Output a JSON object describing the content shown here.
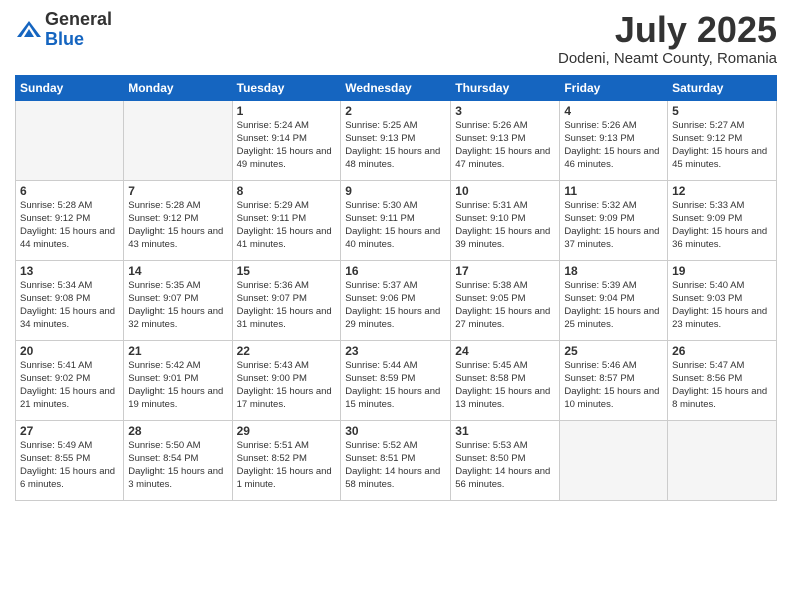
{
  "header": {
    "logo_general": "General",
    "logo_blue": "Blue",
    "month": "July 2025",
    "location": "Dodeni, Neamt County, Romania"
  },
  "weekdays": [
    "Sunday",
    "Monday",
    "Tuesday",
    "Wednesday",
    "Thursday",
    "Friday",
    "Saturday"
  ],
  "weeks": [
    [
      {
        "day": "",
        "info": ""
      },
      {
        "day": "",
        "info": ""
      },
      {
        "day": "1",
        "info": "Sunrise: 5:24 AM\nSunset: 9:14 PM\nDaylight: 15 hours and 49 minutes."
      },
      {
        "day": "2",
        "info": "Sunrise: 5:25 AM\nSunset: 9:13 PM\nDaylight: 15 hours and 48 minutes."
      },
      {
        "day": "3",
        "info": "Sunrise: 5:26 AM\nSunset: 9:13 PM\nDaylight: 15 hours and 47 minutes."
      },
      {
        "day": "4",
        "info": "Sunrise: 5:26 AM\nSunset: 9:13 PM\nDaylight: 15 hours and 46 minutes."
      },
      {
        "day": "5",
        "info": "Sunrise: 5:27 AM\nSunset: 9:12 PM\nDaylight: 15 hours and 45 minutes."
      }
    ],
    [
      {
        "day": "6",
        "info": "Sunrise: 5:28 AM\nSunset: 9:12 PM\nDaylight: 15 hours and 44 minutes."
      },
      {
        "day": "7",
        "info": "Sunrise: 5:28 AM\nSunset: 9:12 PM\nDaylight: 15 hours and 43 minutes."
      },
      {
        "day": "8",
        "info": "Sunrise: 5:29 AM\nSunset: 9:11 PM\nDaylight: 15 hours and 41 minutes."
      },
      {
        "day": "9",
        "info": "Sunrise: 5:30 AM\nSunset: 9:11 PM\nDaylight: 15 hours and 40 minutes."
      },
      {
        "day": "10",
        "info": "Sunrise: 5:31 AM\nSunset: 9:10 PM\nDaylight: 15 hours and 39 minutes."
      },
      {
        "day": "11",
        "info": "Sunrise: 5:32 AM\nSunset: 9:09 PM\nDaylight: 15 hours and 37 minutes."
      },
      {
        "day": "12",
        "info": "Sunrise: 5:33 AM\nSunset: 9:09 PM\nDaylight: 15 hours and 36 minutes."
      }
    ],
    [
      {
        "day": "13",
        "info": "Sunrise: 5:34 AM\nSunset: 9:08 PM\nDaylight: 15 hours and 34 minutes."
      },
      {
        "day": "14",
        "info": "Sunrise: 5:35 AM\nSunset: 9:07 PM\nDaylight: 15 hours and 32 minutes."
      },
      {
        "day": "15",
        "info": "Sunrise: 5:36 AM\nSunset: 9:07 PM\nDaylight: 15 hours and 31 minutes."
      },
      {
        "day": "16",
        "info": "Sunrise: 5:37 AM\nSunset: 9:06 PM\nDaylight: 15 hours and 29 minutes."
      },
      {
        "day": "17",
        "info": "Sunrise: 5:38 AM\nSunset: 9:05 PM\nDaylight: 15 hours and 27 minutes."
      },
      {
        "day": "18",
        "info": "Sunrise: 5:39 AM\nSunset: 9:04 PM\nDaylight: 15 hours and 25 minutes."
      },
      {
        "day": "19",
        "info": "Sunrise: 5:40 AM\nSunset: 9:03 PM\nDaylight: 15 hours and 23 minutes."
      }
    ],
    [
      {
        "day": "20",
        "info": "Sunrise: 5:41 AM\nSunset: 9:02 PM\nDaylight: 15 hours and 21 minutes."
      },
      {
        "day": "21",
        "info": "Sunrise: 5:42 AM\nSunset: 9:01 PM\nDaylight: 15 hours and 19 minutes."
      },
      {
        "day": "22",
        "info": "Sunrise: 5:43 AM\nSunset: 9:00 PM\nDaylight: 15 hours and 17 minutes."
      },
      {
        "day": "23",
        "info": "Sunrise: 5:44 AM\nSunset: 8:59 PM\nDaylight: 15 hours and 15 minutes."
      },
      {
        "day": "24",
        "info": "Sunrise: 5:45 AM\nSunset: 8:58 PM\nDaylight: 15 hours and 13 minutes."
      },
      {
        "day": "25",
        "info": "Sunrise: 5:46 AM\nSunset: 8:57 PM\nDaylight: 15 hours and 10 minutes."
      },
      {
        "day": "26",
        "info": "Sunrise: 5:47 AM\nSunset: 8:56 PM\nDaylight: 15 hours and 8 minutes."
      }
    ],
    [
      {
        "day": "27",
        "info": "Sunrise: 5:49 AM\nSunset: 8:55 PM\nDaylight: 15 hours and 6 minutes."
      },
      {
        "day": "28",
        "info": "Sunrise: 5:50 AM\nSunset: 8:54 PM\nDaylight: 15 hours and 3 minutes."
      },
      {
        "day": "29",
        "info": "Sunrise: 5:51 AM\nSunset: 8:52 PM\nDaylight: 15 hours and 1 minute."
      },
      {
        "day": "30",
        "info": "Sunrise: 5:52 AM\nSunset: 8:51 PM\nDaylight: 14 hours and 58 minutes."
      },
      {
        "day": "31",
        "info": "Sunrise: 5:53 AM\nSunset: 8:50 PM\nDaylight: 14 hours and 56 minutes."
      },
      {
        "day": "",
        "info": ""
      },
      {
        "day": "",
        "info": ""
      }
    ]
  ]
}
